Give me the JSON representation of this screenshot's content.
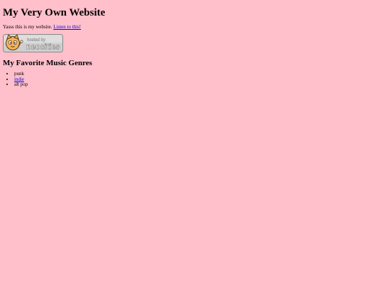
{
  "page": {
    "title": "My Very Own Website",
    "intro_text": "Yasss this is my website. ",
    "intro_link": "Listen to this!"
  },
  "badge": {
    "line1": "hosted by",
    "line2": "neocities"
  },
  "genres": {
    "heading": "My Favorite Music Genres",
    "items": [
      "punk",
      "indie",
      "alt pop"
    ]
  },
  "colors": {
    "background": "#ffc0cb",
    "link": "#0000ee"
  }
}
